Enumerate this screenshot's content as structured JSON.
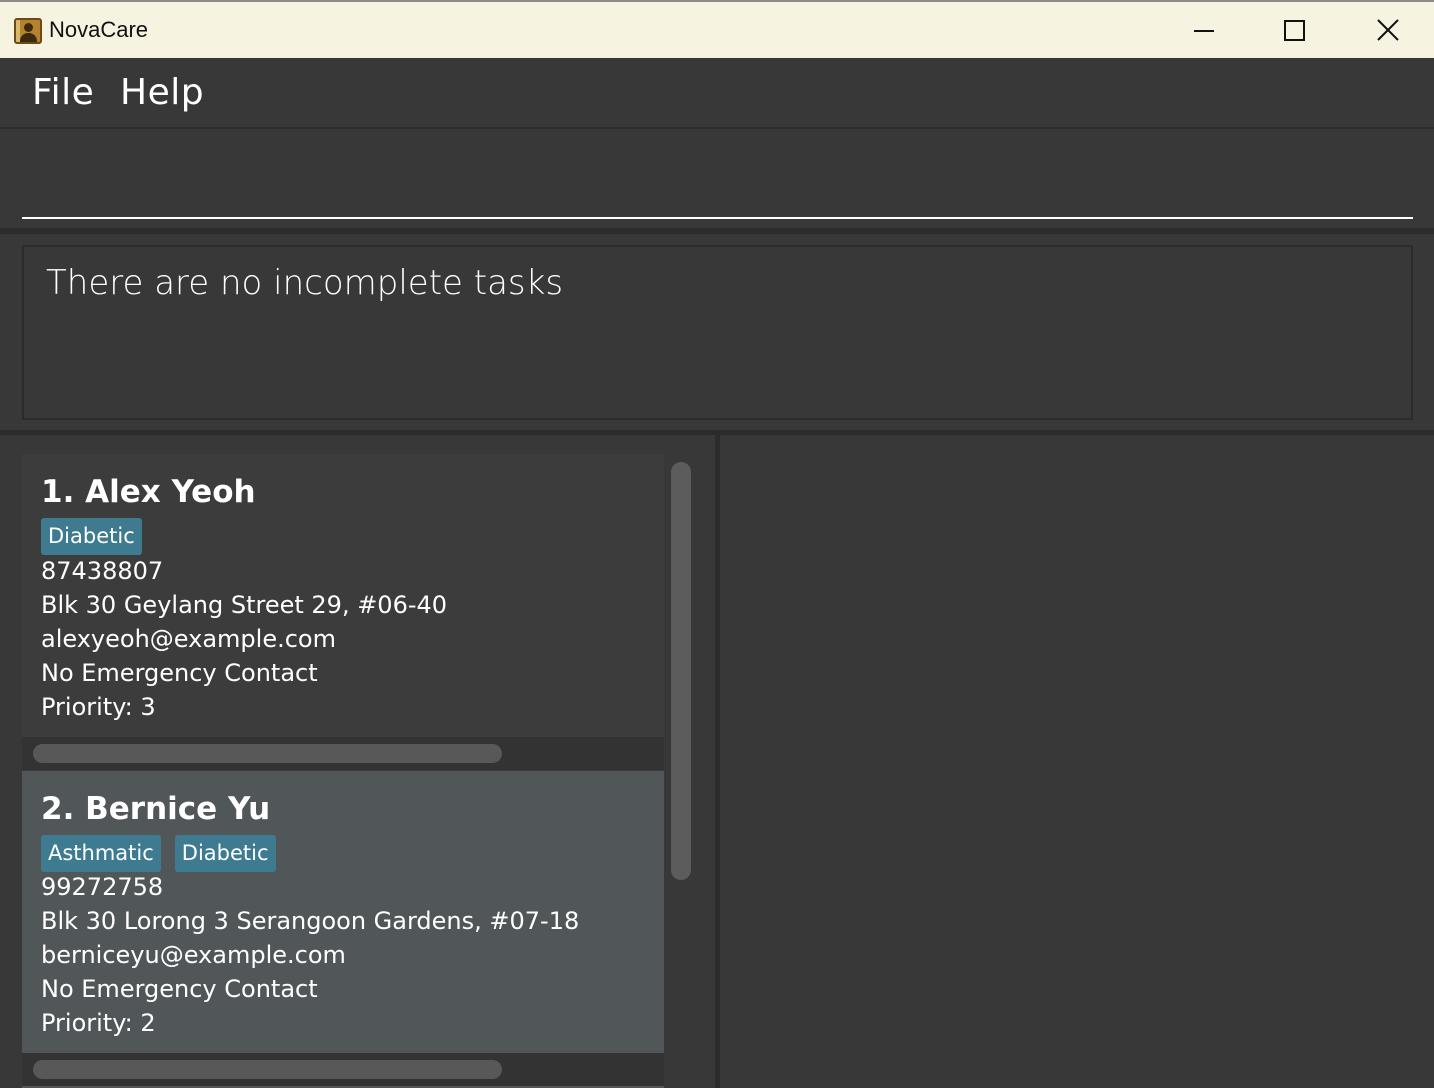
{
  "window": {
    "title": "NovaCare"
  },
  "menu": {
    "file_label": "File",
    "help_label": "Help"
  },
  "command": {
    "value": "",
    "placeholder": ""
  },
  "result": {
    "message": "There are no incomplete tasks"
  },
  "persons": [
    {
      "name": "1. Alex Yeoh",
      "tags": [
        "Diabetic"
      ],
      "phone": "87438807",
      "address": "Blk 30 Geylang Street 29, #06-40",
      "email": "alexyeoh@example.com",
      "emergency_contact": "No Emergency Contact",
      "priority": "Priority: 3",
      "selected": false
    },
    {
      "name": "2. Bernice Yu",
      "tags": [
        "Asthmatic",
        "Diabetic"
      ],
      "phone": "99272758",
      "address": "Blk 30 Lorong 3 Serangoon Gardens, #07-18",
      "email": "berniceyu@example.com",
      "emergency_contact": "No Emergency Contact",
      "priority": "Priority: 2",
      "selected": true
    }
  ],
  "colors": {
    "background": "#383838",
    "titlebar": "#f7f3e1",
    "tag": "#3e7b91",
    "selected_card": "#515658",
    "card": "#3c3c3c"
  }
}
